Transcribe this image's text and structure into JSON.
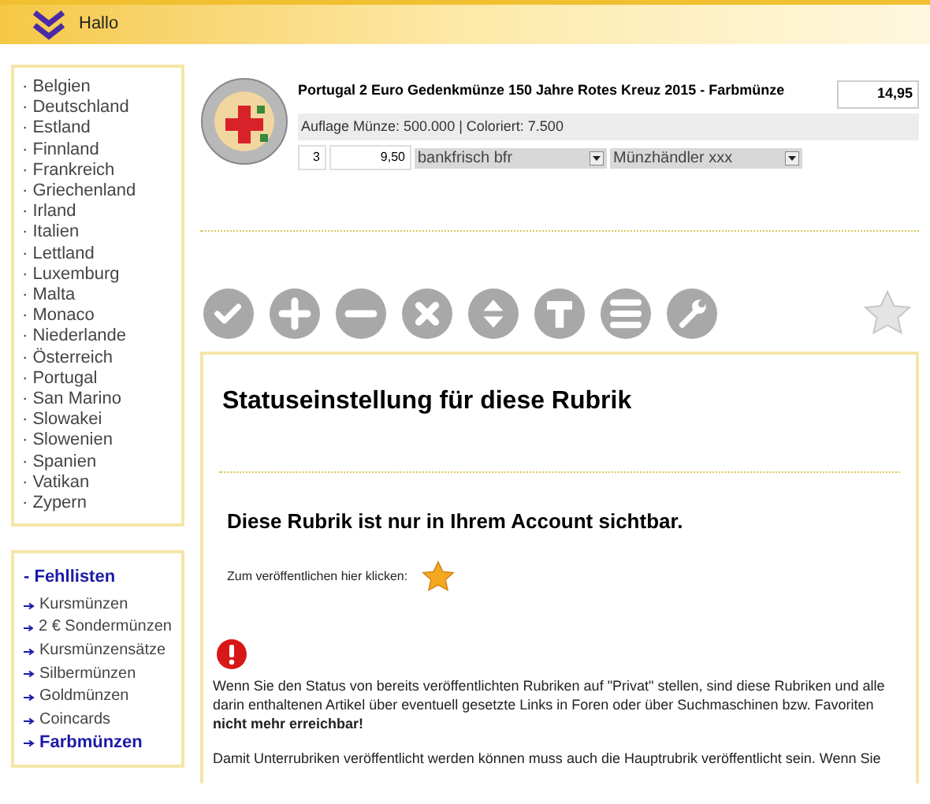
{
  "header": {
    "greeting": "Hallo"
  },
  "countries": [
    "Belgien",
    "Deutschland",
    "Estland",
    "Finnland",
    "Frankreich",
    "Griechenland",
    "Irland",
    "Italien",
    "Lettland",
    "Luxemburg",
    "Malta",
    "Monaco",
    "Niederlande",
    "Österreich",
    "Portugal",
    "San Marino",
    "Slowakei",
    "Slowenien",
    "Spanien",
    "Vatikan",
    "Zypern"
  ],
  "bullet": "·",
  "lists_title": "- Fehllisten",
  "lists": [
    {
      "label": "Kursmünzen",
      "selected": false
    },
    {
      "label": "2 € Sondermünzen",
      "selected": false
    },
    {
      "label": "Kursmünzensätze",
      "selected": false
    },
    {
      "label": "Silbermünzen",
      "selected": false
    },
    {
      "label": "Goldmünzen",
      "selected": false
    },
    {
      "label": "Coincards",
      "selected": false
    },
    {
      "label": "Farbmünzen",
      "selected": true
    }
  ],
  "item": {
    "title": "Portugal 2 Euro Gedenkmünze 150 Jahre Rotes Kreuz 2015 - Farbmünze",
    "price": "14,95",
    "details": "Auflage Münze: 500.000 | Coloriert: 7.500",
    "quantity": "3",
    "buy_price": "9,50",
    "condition": "bankfrisch bfr",
    "dealer": "Münzhändler xxx"
  },
  "status": {
    "title": "Statuseinstellung für diese Rubrik",
    "message": "Diese Rubrik ist nur in Ihrem Account sichtbar.",
    "publish_label": "Zum veröffentlichen hier klicken:",
    "warning": "Wenn Sie den Status von bereits veröffentlichten Rubriken auf \"Privat\" stellen, sind diese Rubriken und alle darin enthaltenen Artikel über eventuell gesetzte Links in Foren oder über Suchmaschinen bzw. Favoriten **nicht mehr erreichbar!**",
    "note": "Damit Unterrubriken veröffentlicht werden können muss auch die Hauptrubrik veröffentlicht sein. Wenn Sie"
  }
}
